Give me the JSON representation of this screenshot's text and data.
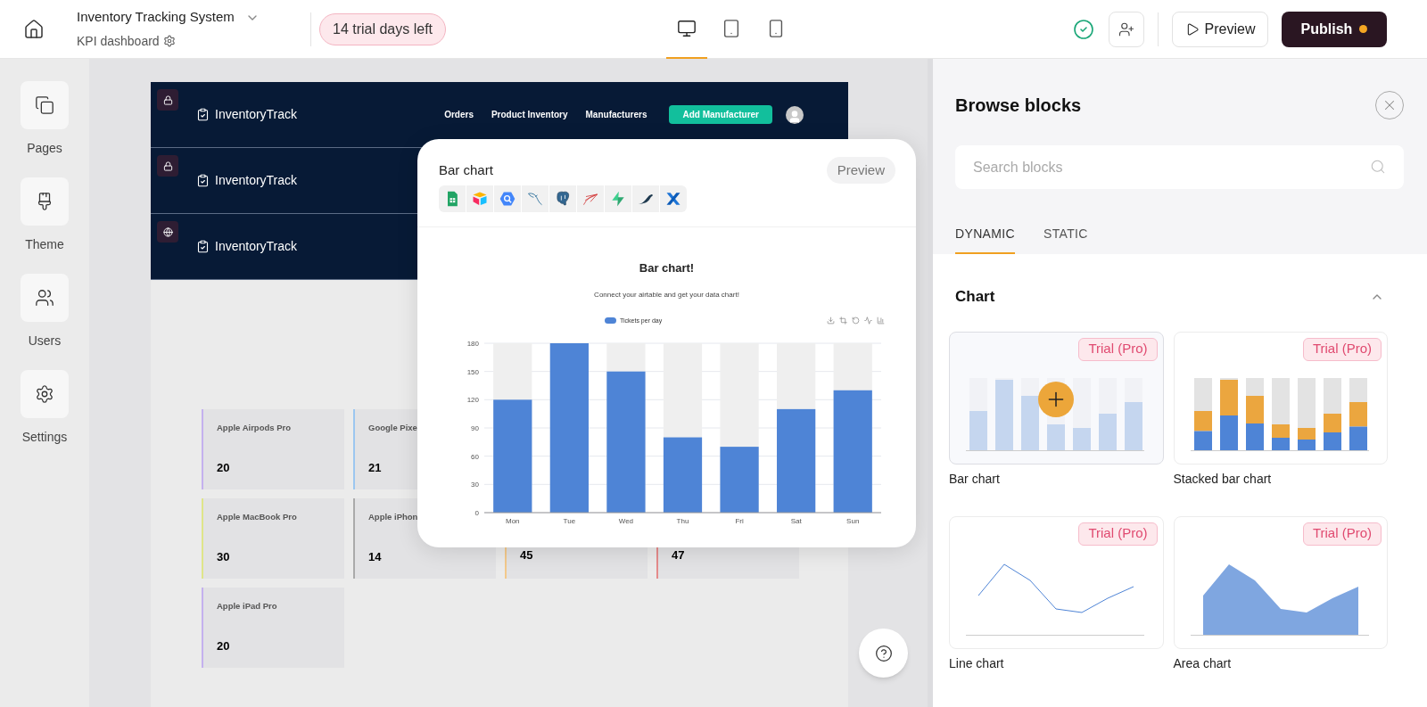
{
  "topbar": {
    "app_title": "Inventory Tracking System",
    "page_name": "KPI dashboard",
    "trial_badge": "14 trial days left",
    "devices": [
      {
        "kind": "desktop",
        "selected": true
      },
      {
        "kind": "tablet",
        "selected": false
      },
      {
        "kind": "phone",
        "selected": false
      }
    ],
    "preview_button": "Preview",
    "publish_button": "Publish",
    "unpublished_changes": true
  },
  "sidebar": {
    "items": [
      {
        "kind": "pages",
        "label": "Pages"
      },
      {
        "kind": "theme",
        "label": "Theme"
      },
      {
        "kind": "users",
        "label": "Users"
      },
      {
        "kind": "settings",
        "label": "Settings"
      }
    ]
  },
  "canvas": {
    "headers": [
      {
        "badge": {
          "kind": "lock"
        },
        "brand": "InventoryTrack",
        "nav": [
          "Orders",
          "Product Inventory",
          "Manufacturers"
        ],
        "cta": "Add Manufacturer",
        "avatar": true
      },
      {
        "badge": {
          "kind": "lock"
        },
        "brand": "InventoryTrack"
      },
      {
        "badge": {
          "kind": "globe"
        },
        "brand": "InventoryTrack"
      }
    ],
    "card_rows": [
      [
        {
          "name": "Apple Airpods Pro",
          "value": "20",
          "color": "#c4b1ee"
        },
        {
          "name": "Google Pixe",
          "value": "21",
          "color": "#9cc7f0"
        }
      ],
      [
        {
          "name": "Apple MacBook Pro",
          "value": "30",
          "color": "#dfe58a"
        },
        {
          "name": "Apple iPhon",
          "value": "14",
          "color": "#aaaaaa"
        },
        {
          "value": "45",
          "color": "#f3c98b"
        },
        {
          "value": "47",
          "color": "#e58b8b"
        }
      ],
      [
        {
          "name": "Apple iPad Pro",
          "value": "20",
          "color": "#c4b1ee"
        }
      ]
    ]
  },
  "block_preview": {
    "title": "Bar chart",
    "preview_button": "Preview",
    "sources": [
      {
        "kind": "sheets"
      },
      {
        "kind": "airtable"
      },
      {
        "kind": "bigquery"
      },
      {
        "kind": "mysql"
      },
      {
        "kind": "postgres"
      },
      {
        "kind": "sqlserver"
      },
      {
        "kind": "supabase"
      },
      {
        "kind": "mariadb"
      },
      {
        "kind": "xano"
      }
    ],
    "subtitle": "Connect your airtable and get your data chart!",
    "chart_data": {
      "type": "bar",
      "title": "Bar chart!",
      "categories": [
        "Mon",
        "Tue",
        "Wed",
        "Thu",
        "Fri",
        "Sat",
        "Sun"
      ],
      "series": [
        {
          "name": "Tickets per day",
          "color": "#4e84d6",
          "values": [
            120,
            180,
            150,
            80,
            70,
            110,
            130
          ]
        }
      ],
      "ylim": [
        0,
        180
      ],
      "yticks": [
        0,
        30,
        60,
        90,
        120,
        150,
        180
      ],
      "grid": true
    }
  },
  "browse_panel": {
    "title": "Browse blocks",
    "search_placeholder": "Search blocks",
    "tabs": [
      {
        "label": "DYNAMIC",
        "selected": true
      },
      {
        "label": "STATIC",
        "selected": false
      }
    ],
    "section": {
      "title": "Chart",
      "expanded": true,
      "blocks": [
        {
          "kind": "bar",
          "label": "Bar chart",
          "badge": "Trial (Pro)",
          "hovered": true
        },
        {
          "kind": "stacked",
          "label": "Stacked bar chart",
          "badge": "Trial (Pro)",
          "hovered": false
        },
        {
          "kind": "line",
          "label": "Line chart",
          "badge": "Trial (Pro)",
          "hovered": false
        },
        {
          "kind": "area",
          "label": "Area chart",
          "badge": "Trial (Pro)",
          "hovered": false
        }
      ]
    }
  }
}
